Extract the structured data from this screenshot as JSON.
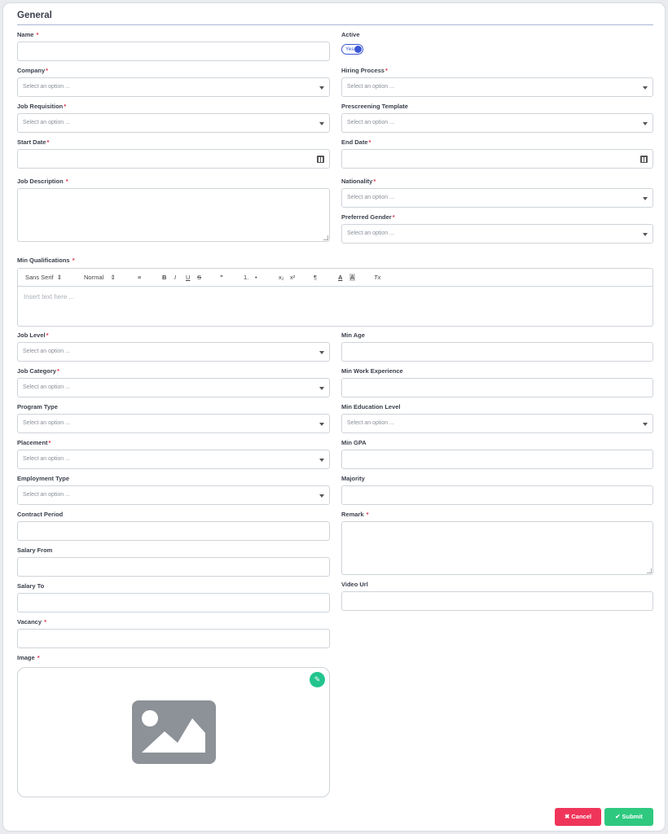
{
  "section": {
    "title": "General"
  },
  "placeholder_select": "Select an option ...",
  "fields": {
    "name": "Name",
    "active": "Active",
    "active_value": "Yes",
    "company": "Company",
    "hiring_process": "Hiring Process",
    "job_requisition": "Job Requisition",
    "prescreening_template": "Prescreening Template",
    "start_date": "Start Date",
    "end_date": "End Date",
    "job_description": "Job Description",
    "nationality": "Nationality",
    "preferred_gender": "Preferred Gender",
    "min_qualifications": "Min Qualifications",
    "job_level": "Job Level",
    "min_age": "Min Age",
    "job_category": "Job Category",
    "min_work_experience": "Min Work Experience",
    "program_type": "Program Type",
    "min_education_level": "Min Education Level",
    "placement": "Placement",
    "min_gpa": "Min GPA",
    "employment_type": "Employment Type",
    "majority": "Majority",
    "contract_period": "Contract Period",
    "remark": "Remark",
    "salary_from": "Salary From",
    "salary_to": "Salary To",
    "video_url": "Video Url",
    "vacancy": "Vacancy",
    "image": "Image"
  },
  "editor": {
    "font": "Sans Serif",
    "size": "Normal",
    "placeholder": "Insert text here ...",
    "tools": [
      "B",
      "I",
      "U",
      "S",
      "”",
      "1.",
      "•",
      "x₂",
      "x²",
      "¶",
      "A",
      "A",
      "Tx"
    ]
  },
  "buttons": {
    "cancel": "Cancel",
    "submit": "Submit"
  },
  "colors": {
    "primary": "#3b56d6",
    "danger": "#f0355a",
    "success": "#2ec97f",
    "required": "#e0344f"
  }
}
